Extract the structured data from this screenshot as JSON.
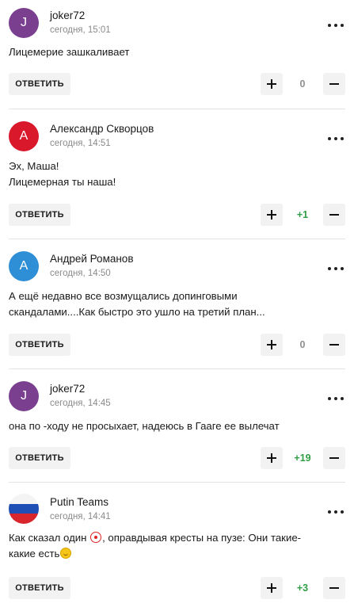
{
  "comments": [
    {
      "avatar_letter": "J",
      "avatar_color": "#7a3f8f",
      "author": "joker72",
      "time": "сегодня, 15:01",
      "text_lines": [
        "Лицемерие зашкаливает"
      ],
      "reply_label": "ОТВЕТИТЬ",
      "score": "0"
    },
    {
      "avatar_letter": "А",
      "avatar_color": "#d9182c",
      "author": "Александр Скворцов",
      "time": "сегодня, 14:51",
      "text_lines": [
        "Эх, Маша!",
        "Лицемерная ты наша!"
      ],
      "reply_label": "ОТВЕТИТЬ",
      "score": "+1"
    },
    {
      "avatar_letter": "А",
      "avatar_color": "#2e8ed6",
      "author": "Андрей Романов",
      "time": "сегодня, 14:50",
      "text_lines": [
        "А ещё недавно все возмущались допинговыми",
        "скандалами....Как быстро это ушло на третий план..."
      ],
      "reply_label": "ОТВЕТИТЬ",
      "score": "0"
    },
    {
      "avatar_letter": "J",
      "avatar_color": "#7a3f8f",
      "author": "joker72",
      "time": "сегодня, 14:45",
      "text_lines": [
        "она по -ходу не просыхает, надеюсь в Гааге ее вылечат"
      ],
      "reply_label": "ОТВЕТИТЬ",
      "score": "+19"
    },
    {
      "avatar_icon": "russian-flag-avatar",
      "author": "Putin Teams",
      "time": "сегодня, 14:41",
      "text_line1_before": "Как сказал один ",
      "text_line1_after": ", оправдывая кресты на пузе: Они такие-",
      "text_line2": "какие есть",
      "emoji1": "clown-emoji",
      "emoji2": "smile-emoji",
      "reply_label": "ОТВЕТИТЬ",
      "score": "+3"
    }
  ],
  "colors": {
    "score_positive": "#2f9e44",
    "score_zero": "#8f8f8f",
    "button_bg": "#f2f2f2",
    "divider": "#e3e3e3"
  }
}
